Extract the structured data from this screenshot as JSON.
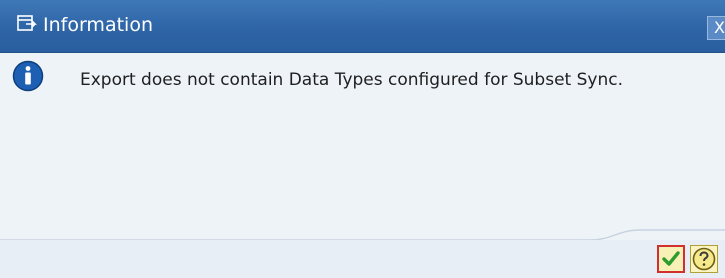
{
  "window": {
    "title": "Information",
    "title_icon": "window-menu-icon",
    "close_label": "X",
    "close_icon": "close-icon"
  },
  "message": {
    "icon": "info-icon",
    "text": "Export does not contain Data Types configured for Subset Sync."
  },
  "buttons": {
    "ok_icon": "checkmark-icon",
    "help_icon": "help-question-icon"
  },
  "colors": {
    "titlebar": "#2f66a8",
    "background": "#eef3f8",
    "info_icon": "#1d5fb3",
    "ok_border": "#d22f2f",
    "checkmark": "#2e9b2f"
  }
}
